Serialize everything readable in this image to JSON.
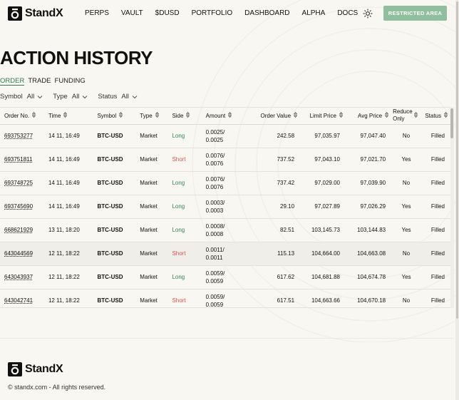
{
  "brand": {
    "name": "StandX"
  },
  "nav": [
    "PERPS",
    "VAULT",
    "$DUSD",
    "PORTFOLIO",
    "DASHBOARD",
    "ALPHA",
    "DOCS"
  ],
  "header": {
    "restricted_label": "RESTRICTED AREA"
  },
  "page_title": "ACTION HISTORY",
  "tabs": [
    {
      "label": "ORDER",
      "active": true
    },
    {
      "label": "TRADE",
      "active": false
    },
    {
      "label": "FUNDING",
      "active": false
    }
  ],
  "filters": [
    {
      "label": "Symbol",
      "value": "All"
    },
    {
      "label": "Type",
      "value": "All"
    },
    {
      "label": "Status",
      "value": "All"
    }
  ],
  "columns": [
    "Order No.",
    "Time",
    "Symbol",
    "Type",
    "Side",
    "Amount",
    "Order Value",
    "Limit Price",
    "Avg Price",
    "Reduce Only",
    "Status"
  ],
  "rows": [
    {
      "order_no": "693753277",
      "time": "14 11, 16:49",
      "symbol": "BTC-USD",
      "type": "Market",
      "side": "Long",
      "amount_1": "0.0025/",
      "amount_2": "0.0025",
      "order_value": "242.58",
      "limit_price": "97,035.97",
      "avg_price": "97,047.40",
      "reduce_only": "No",
      "status": "Filled"
    },
    {
      "order_no": "693751811",
      "time": "14 11, 16:49",
      "symbol": "BTC-USD",
      "type": "Market",
      "side": "Short",
      "amount_1": "0.0076/",
      "amount_2": "0.0076",
      "order_value": "737.52",
      "limit_price": "97,043.10",
      "avg_price": "97,021.70",
      "reduce_only": "Yes",
      "status": "Filled"
    },
    {
      "order_no": "693748725",
      "time": "14 11, 16:49",
      "symbol": "BTC-USD",
      "type": "Market",
      "side": "Long",
      "amount_1": "0.0076/",
      "amount_2": "0.0076",
      "order_value": "737.42",
      "limit_price": "97,029.00",
      "avg_price": "97,039.90",
      "reduce_only": "No",
      "status": "Filled"
    },
    {
      "order_no": "693745690",
      "time": "14 11, 16:49",
      "symbol": "BTC-USD",
      "type": "Market",
      "side": "Long",
      "amount_1": "0.0003/",
      "amount_2": "0.0003",
      "order_value": "29.10",
      "limit_price": "97,027.89",
      "avg_price": "97,026.29",
      "reduce_only": "Yes",
      "status": "Filled"
    },
    {
      "order_no": "668621929",
      "time": "13 11, 18:20",
      "symbol": "BTC-USD",
      "type": "Market",
      "side": "Long",
      "amount_1": "0.0008/",
      "amount_2": "0.0008",
      "order_value": "82.51",
      "limit_price": "103,145.73",
      "avg_price": "103,144.83",
      "reduce_only": "Yes",
      "status": "Filled"
    },
    {
      "order_no": "643044569",
      "time": "12 11, 18:22",
      "symbol": "BTC-USD",
      "type": "Market",
      "side": "Short",
      "amount_1": "0.0011/",
      "amount_2": "0.0011",
      "order_value": "115.13",
      "limit_price": "104,664.00",
      "avg_price": "104,663.08",
      "reduce_only": "No",
      "status": "Filled"
    },
    {
      "order_no": "643043937",
      "time": "12 11, 18:22",
      "symbol": "BTC-USD",
      "type": "Market",
      "side": "Long",
      "amount_1": "0.0059/",
      "amount_2": "0.0059",
      "order_value": "617.62",
      "limit_price": "104,681.88",
      "avg_price": "104,674.78",
      "reduce_only": "Yes",
      "status": "Filled"
    },
    {
      "order_no": "643042741",
      "time": "12 11, 18:22",
      "symbol": "BTC-USD",
      "type": "Market",
      "side": "Short",
      "amount_1": "0.0059/",
      "amount_2": "0.0059",
      "order_value": "617.51",
      "limit_price": "104,663.66",
      "avg_price": "104,670.18",
      "reduce_only": "No",
      "status": "Filled"
    }
  ],
  "footer": {
    "copyright": "© standx.com - All rights reserved."
  },
  "colors": {
    "accent": "#2e7d4f",
    "long": "#2e8b57",
    "short": "#d9534f",
    "restricted_bg": "#8fbf9d",
    "background": "#f8f7f1"
  },
  "icons": [
    "standx-logo-icon",
    "sun-icon",
    "chevron-down-icon",
    "sort-icon"
  ]
}
